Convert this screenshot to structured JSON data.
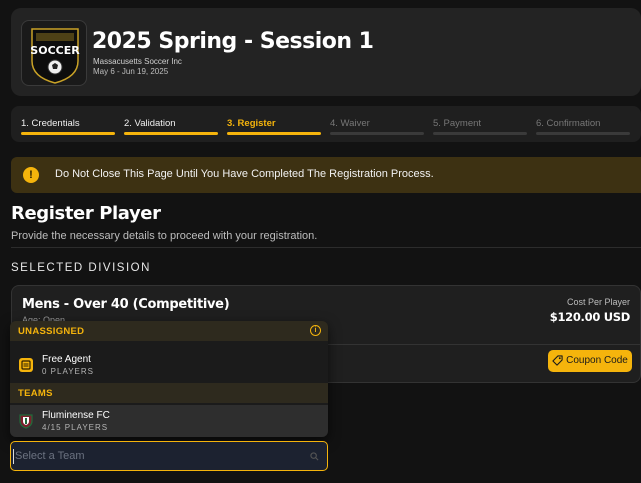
{
  "event": {
    "title": "2025 Spring - Session 1",
    "organization": "Massacusetts Soccer Inc",
    "dates": "May 6 - Jun 19, 2025",
    "logo_text": "SOCCER"
  },
  "steps": [
    {
      "label": "1. Credentials",
      "state": "done"
    },
    {
      "label": "2. Validation",
      "state": "done"
    },
    {
      "label": "3. Register",
      "state": "active"
    },
    {
      "label": "4. Waiver",
      "state": "todo"
    },
    {
      "label": "5. Payment",
      "state": "todo"
    },
    {
      "label": "6. Confirmation",
      "state": "todo"
    }
  ],
  "alert": {
    "icon": "!",
    "text": "Do Not Close This Page Until You Have Completed The Registration Process."
  },
  "register": {
    "title": "Register Player",
    "subtitle": "Provide the necessary details to proceed with your registration.",
    "section_label": "SELECTED DIVISION"
  },
  "division": {
    "name": "Mens - Over 40 (Competitive)",
    "age": "Age: Open",
    "cost_label": "Cost Per Player",
    "cost_value": "$120.00 USD",
    "coupon_label": "Coupon Code"
  },
  "dropdown": {
    "unassigned_label": "UNASSIGNED",
    "teams_label": "TEAMS",
    "free_agent": {
      "name": "Free Agent",
      "count": "0 PLAYERS"
    },
    "teams": [
      {
        "name": "Fluminense FC",
        "count": "4/15 PLAYERS"
      }
    ]
  },
  "team_select": {
    "placeholder": "Select a Team"
  },
  "colors": {
    "accent": "#f5b40c",
    "background": "#121212",
    "card": "#1f1f1f"
  }
}
